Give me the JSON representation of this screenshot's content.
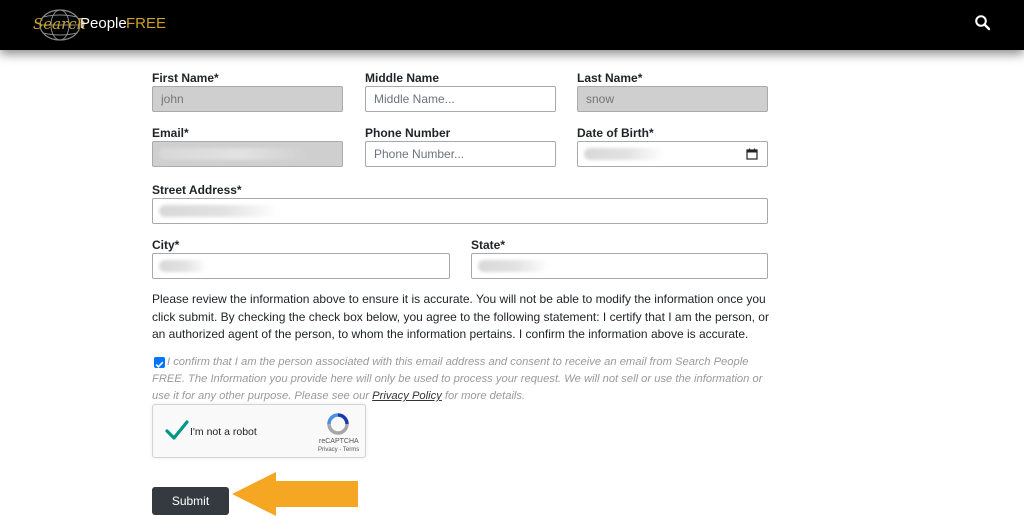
{
  "header": {
    "logo_search": "Search",
    "logo_people": "People",
    "logo_free": "FREE",
    "icon": "search-icon"
  },
  "form": {
    "first_name": {
      "label": "First Name*",
      "value": "john"
    },
    "middle_name": {
      "label": "Middle Name",
      "placeholder": "Middle Name..."
    },
    "last_name": {
      "label": "Last Name*",
      "value": "snow"
    },
    "email": {
      "label": "Email*"
    },
    "phone": {
      "label": "Phone Number",
      "placeholder": "Phone Number..."
    },
    "dob": {
      "label": "Date of Birth*",
      "icon": "calendar-icon"
    },
    "street": {
      "label": "Street Address*"
    },
    "city": {
      "label": "City*"
    },
    "state": {
      "label": "State*"
    }
  },
  "notice": "Please review the information above to ensure it is accurate. You will not be able to modify the information once you click submit. By checking the check box below, you agree to the following statement: I certify that I am the person, or an authorized agent of the person, to whom the information pertains. I confirm the information above is accurate.",
  "consent": {
    "checked": true,
    "text_before": "I confirm that I am the person associated with this email address and consent to receive an email from Search People FREE. The Information you provide here will only be used to process your request. We will not sell or use the information or use it for any other purpose. Please see our ",
    "link": "Privacy Policy",
    "text_after": " for more details."
  },
  "recaptcha": {
    "checked": true,
    "label": "I'm not a robot",
    "brand": "reCAPTCHA",
    "terms": "Privacy - Terms"
  },
  "submit_label": "Submit",
  "colors": {
    "header_bg": "#000000",
    "brand_gold": "#c9a227",
    "submit_bg": "#343a40",
    "arrow": "#f5a623",
    "checkbox": "#0075ff",
    "recaptcha_check": "#009688"
  }
}
